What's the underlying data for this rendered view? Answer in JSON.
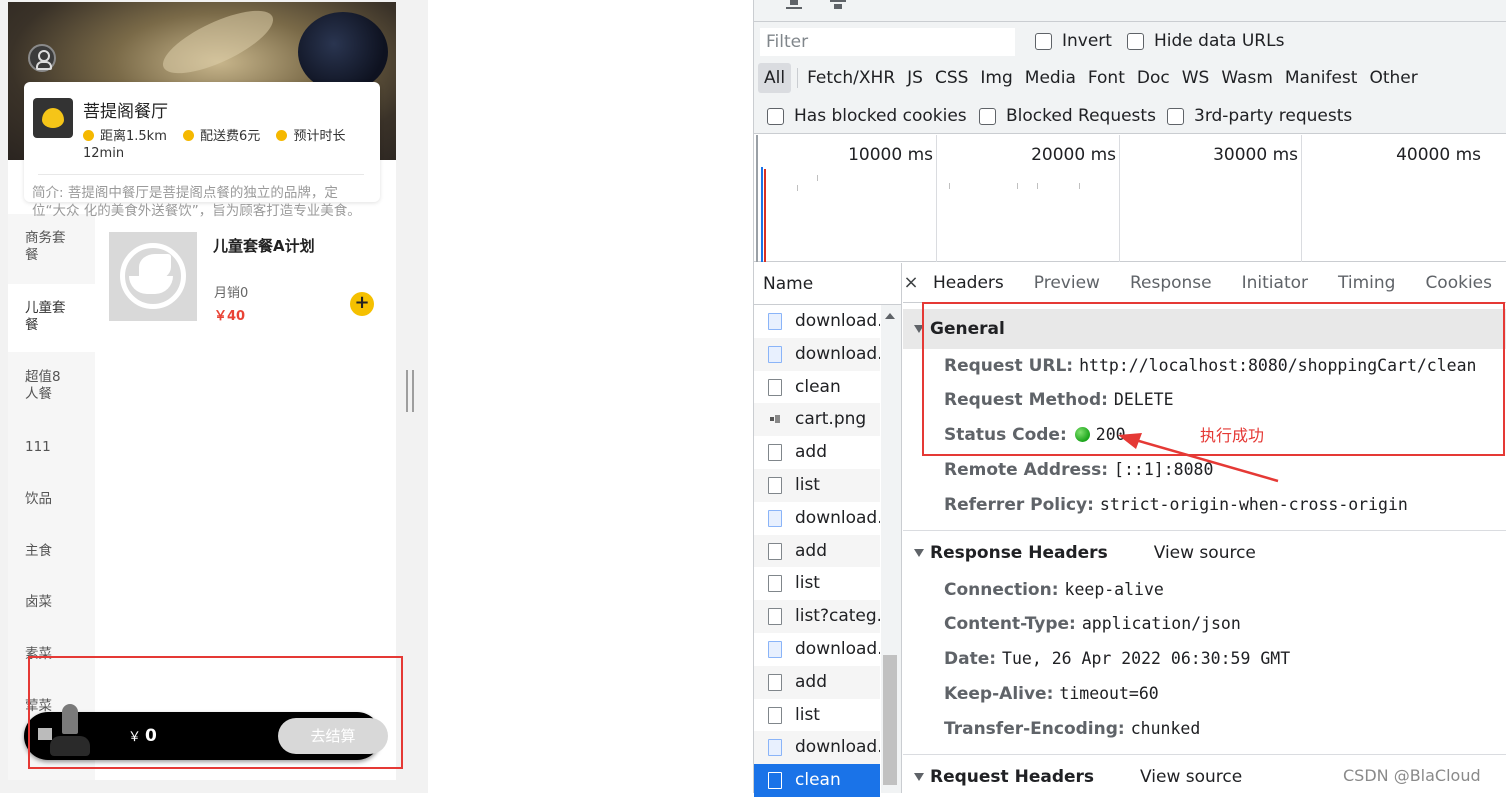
{
  "app": {
    "shop": {
      "name": "菩提阁餐厅",
      "distance": "距离1.5km",
      "delivery_fee": "配送费6元",
      "estimated_label": "预计时长",
      "estimated_time": "12min",
      "intro": "简介: 菩提阁中餐厅是菩提阁点餐的独立的品牌，定位“大众 化的美食外送餐饮”，旨为顾客打造专业美食。"
    },
    "categories": [
      {
        "label": "商务套\n餐",
        "active": false
      },
      {
        "label": "儿童套\n餐",
        "active": true
      },
      {
        "label": "超值8\n人餐",
        "active": false
      },
      {
        "label": "111",
        "active": false
      },
      {
        "label": "饮品",
        "active": false
      },
      {
        "label": "主食",
        "active": false
      },
      {
        "label": "卤菜",
        "active": false
      },
      {
        "label": "素菜",
        "active": false
      },
      {
        "label": "荤菜",
        "active": false
      }
    ],
    "product": {
      "name": "儿童套餐A计划",
      "sales": "月销0",
      "price": "￥40",
      "add_symbol": "+"
    },
    "cart": {
      "currency": "￥",
      "total": "0",
      "checkout_label": "去结算"
    }
  },
  "devtools": {
    "filter": {
      "placeholder": "Filter",
      "invert": "Invert",
      "hide_data_urls": "Hide data URLs",
      "types": [
        "All",
        "Fetch/XHR",
        "JS",
        "CSS",
        "Img",
        "Media",
        "Font",
        "Doc",
        "WS",
        "Wasm",
        "Manifest",
        "Other"
      ],
      "has_blocked_cookies": "Has blocked cookies",
      "blocked_requests": "Blocked Requests",
      "third_party": "3rd-party requests"
    },
    "timeline": {
      "labels": [
        "10000 ms",
        "20000 ms",
        "30000 ms",
        "40000 ms"
      ]
    },
    "requests": {
      "header": "Name",
      "rows": [
        {
          "name": "download.",
          "icon": "img"
        },
        {
          "name": "download.",
          "icon": "img"
        },
        {
          "name": "clean",
          "icon": "doc"
        },
        {
          "name": "cart.png",
          "icon": "png"
        },
        {
          "name": "add",
          "icon": "doc"
        },
        {
          "name": "list",
          "icon": "doc"
        },
        {
          "name": "download.",
          "icon": "img"
        },
        {
          "name": "add",
          "icon": "doc"
        },
        {
          "name": "list",
          "icon": "doc"
        },
        {
          "name": "list?categ..",
          "icon": "doc"
        },
        {
          "name": "download.",
          "icon": "img"
        },
        {
          "name": "add",
          "icon": "doc"
        },
        {
          "name": "list",
          "icon": "doc"
        },
        {
          "name": "download.",
          "icon": "img"
        },
        {
          "name": "clean",
          "icon": "doc",
          "selected": true
        }
      ]
    },
    "tabs": {
      "close": "×",
      "items": [
        "Headers",
        "Preview",
        "Response",
        "Initiator",
        "Timing",
        "Cookies"
      ]
    },
    "general": {
      "title": "General",
      "request_url_k": "Request URL:",
      "request_url_v": "http://localhost:8080/shoppingCart/clean",
      "request_method_k": "Request Method:",
      "request_method_v": "DELETE",
      "status_code_k": "Status Code:",
      "status_code_v": "200",
      "remote_address_k": "Remote Address:",
      "remote_address_v": "[::1]:8080",
      "referrer_policy_k": "Referrer Policy:",
      "referrer_policy_v": "strict-origin-when-cross-origin"
    },
    "response_headers": {
      "title": "Response Headers",
      "view_source": "View source",
      "connection_k": "Connection:",
      "connection_v": "keep-alive",
      "content_type_k": "Content-Type:",
      "content_type_v": "application/json",
      "date_k": "Date:",
      "date_v": "Tue, 26 Apr 2022 06:30:59 GMT",
      "keep_alive_k": "Keep-Alive:",
      "keep_alive_v": "timeout=60",
      "transfer_encoding_k": "Transfer-Encoding:",
      "transfer_encoding_v": "chunked"
    },
    "request_headers": {
      "title": "Request Headers",
      "view_source": "View source"
    }
  },
  "annotation": {
    "text": "执行成功",
    "color": "#e53935"
  },
  "watermark": "CSDN @BlaCloud"
}
